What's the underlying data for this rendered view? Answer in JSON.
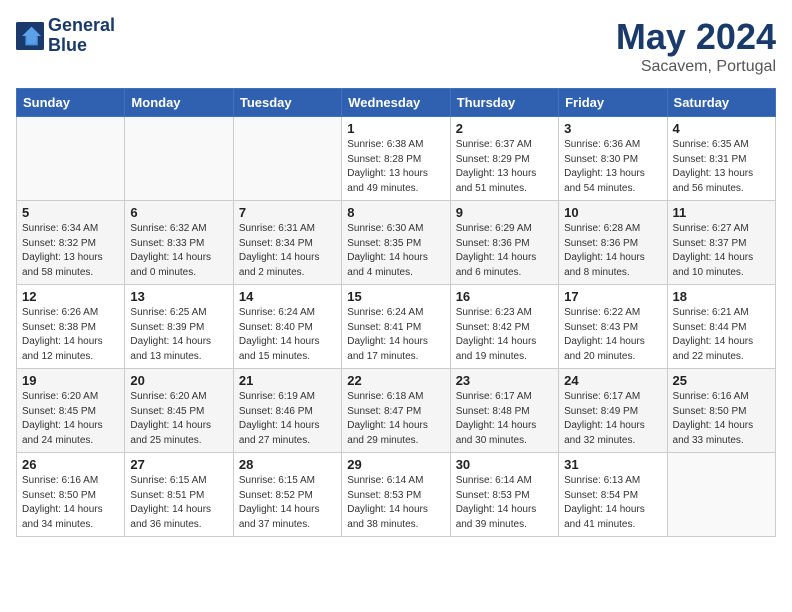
{
  "header": {
    "logo_line1": "General",
    "logo_line2": "Blue",
    "month": "May 2024",
    "location": "Sacavem, Portugal"
  },
  "days_of_week": [
    "Sunday",
    "Monday",
    "Tuesday",
    "Wednesday",
    "Thursday",
    "Friday",
    "Saturday"
  ],
  "weeks": [
    [
      {
        "day": "",
        "info": ""
      },
      {
        "day": "",
        "info": ""
      },
      {
        "day": "",
        "info": ""
      },
      {
        "day": "1",
        "info": "Sunrise: 6:38 AM\nSunset: 8:28 PM\nDaylight: 13 hours\nand 49 minutes."
      },
      {
        "day": "2",
        "info": "Sunrise: 6:37 AM\nSunset: 8:29 PM\nDaylight: 13 hours\nand 51 minutes."
      },
      {
        "day": "3",
        "info": "Sunrise: 6:36 AM\nSunset: 8:30 PM\nDaylight: 13 hours\nand 54 minutes."
      },
      {
        "day": "4",
        "info": "Sunrise: 6:35 AM\nSunset: 8:31 PM\nDaylight: 13 hours\nand 56 minutes."
      }
    ],
    [
      {
        "day": "5",
        "info": "Sunrise: 6:34 AM\nSunset: 8:32 PM\nDaylight: 13 hours\nand 58 minutes."
      },
      {
        "day": "6",
        "info": "Sunrise: 6:32 AM\nSunset: 8:33 PM\nDaylight: 14 hours\nand 0 minutes."
      },
      {
        "day": "7",
        "info": "Sunrise: 6:31 AM\nSunset: 8:34 PM\nDaylight: 14 hours\nand 2 minutes."
      },
      {
        "day": "8",
        "info": "Sunrise: 6:30 AM\nSunset: 8:35 PM\nDaylight: 14 hours\nand 4 minutes."
      },
      {
        "day": "9",
        "info": "Sunrise: 6:29 AM\nSunset: 8:36 PM\nDaylight: 14 hours\nand 6 minutes."
      },
      {
        "day": "10",
        "info": "Sunrise: 6:28 AM\nSunset: 8:36 PM\nDaylight: 14 hours\nand 8 minutes."
      },
      {
        "day": "11",
        "info": "Sunrise: 6:27 AM\nSunset: 8:37 PM\nDaylight: 14 hours\nand 10 minutes."
      }
    ],
    [
      {
        "day": "12",
        "info": "Sunrise: 6:26 AM\nSunset: 8:38 PM\nDaylight: 14 hours\nand 12 minutes."
      },
      {
        "day": "13",
        "info": "Sunrise: 6:25 AM\nSunset: 8:39 PM\nDaylight: 14 hours\nand 13 minutes."
      },
      {
        "day": "14",
        "info": "Sunrise: 6:24 AM\nSunset: 8:40 PM\nDaylight: 14 hours\nand 15 minutes."
      },
      {
        "day": "15",
        "info": "Sunrise: 6:24 AM\nSunset: 8:41 PM\nDaylight: 14 hours\nand 17 minutes."
      },
      {
        "day": "16",
        "info": "Sunrise: 6:23 AM\nSunset: 8:42 PM\nDaylight: 14 hours\nand 19 minutes."
      },
      {
        "day": "17",
        "info": "Sunrise: 6:22 AM\nSunset: 8:43 PM\nDaylight: 14 hours\nand 20 minutes."
      },
      {
        "day": "18",
        "info": "Sunrise: 6:21 AM\nSunset: 8:44 PM\nDaylight: 14 hours\nand 22 minutes."
      }
    ],
    [
      {
        "day": "19",
        "info": "Sunrise: 6:20 AM\nSunset: 8:45 PM\nDaylight: 14 hours\nand 24 minutes."
      },
      {
        "day": "20",
        "info": "Sunrise: 6:20 AM\nSunset: 8:45 PM\nDaylight: 14 hours\nand 25 minutes."
      },
      {
        "day": "21",
        "info": "Sunrise: 6:19 AM\nSunset: 8:46 PM\nDaylight: 14 hours\nand 27 minutes."
      },
      {
        "day": "22",
        "info": "Sunrise: 6:18 AM\nSunset: 8:47 PM\nDaylight: 14 hours\nand 29 minutes."
      },
      {
        "day": "23",
        "info": "Sunrise: 6:17 AM\nSunset: 8:48 PM\nDaylight: 14 hours\nand 30 minutes."
      },
      {
        "day": "24",
        "info": "Sunrise: 6:17 AM\nSunset: 8:49 PM\nDaylight: 14 hours\nand 32 minutes."
      },
      {
        "day": "25",
        "info": "Sunrise: 6:16 AM\nSunset: 8:50 PM\nDaylight: 14 hours\nand 33 minutes."
      }
    ],
    [
      {
        "day": "26",
        "info": "Sunrise: 6:16 AM\nSunset: 8:50 PM\nDaylight: 14 hours\nand 34 minutes."
      },
      {
        "day": "27",
        "info": "Sunrise: 6:15 AM\nSunset: 8:51 PM\nDaylight: 14 hours\nand 36 minutes."
      },
      {
        "day": "28",
        "info": "Sunrise: 6:15 AM\nSunset: 8:52 PM\nDaylight: 14 hours\nand 37 minutes."
      },
      {
        "day": "29",
        "info": "Sunrise: 6:14 AM\nSunset: 8:53 PM\nDaylight: 14 hours\nand 38 minutes."
      },
      {
        "day": "30",
        "info": "Sunrise: 6:14 AM\nSunset: 8:53 PM\nDaylight: 14 hours\nand 39 minutes."
      },
      {
        "day": "31",
        "info": "Sunrise: 6:13 AM\nSunset: 8:54 PM\nDaylight: 14 hours\nand 41 minutes."
      },
      {
        "day": "",
        "info": ""
      }
    ]
  ]
}
